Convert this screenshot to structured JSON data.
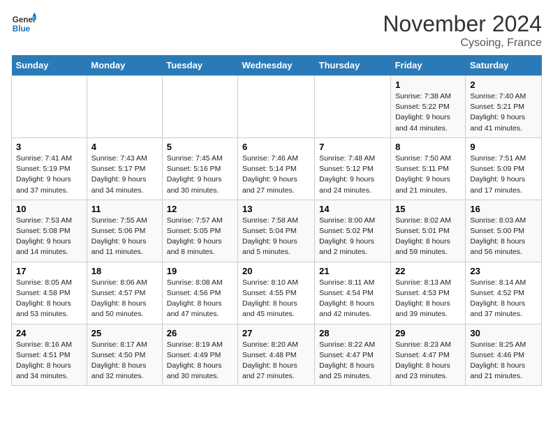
{
  "header": {
    "logo_line1": "General",
    "logo_line2": "Blue",
    "month": "November 2024",
    "location": "Cysoing, France"
  },
  "weekdays": [
    "Sunday",
    "Monday",
    "Tuesday",
    "Wednesday",
    "Thursday",
    "Friday",
    "Saturday"
  ],
  "weeks": [
    [
      {
        "day": "",
        "info": ""
      },
      {
        "day": "",
        "info": ""
      },
      {
        "day": "",
        "info": ""
      },
      {
        "day": "",
        "info": ""
      },
      {
        "day": "",
        "info": ""
      },
      {
        "day": "1",
        "info": "Sunrise: 7:38 AM\nSunset: 5:22 PM\nDaylight: 9 hours\nand 44 minutes."
      },
      {
        "day": "2",
        "info": "Sunrise: 7:40 AM\nSunset: 5:21 PM\nDaylight: 9 hours\nand 41 minutes."
      }
    ],
    [
      {
        "day": "3",
        "info": "Sunrise: 7:41 AM\nSunset: 5:19 PM\nDaylight: 9 hours\nand 37 minutes."
      },
      {
        "day": "4",
        "info": "Sunrise: 7:43 AM\nSunset: 5:17 PM\nDaylight: 9 hours\nand 34 minutes."
      },
      {
        "day": "5",
        "info": "Sunrise: 7:45 AM\nSunset: 5:16 PM\nDaylight: 9 hours\nand 30 minutes."
      },
      {
        "day": "6",
        "info": "Sunrise: 7:46 AM\nSunset: 5:14 PM\nDaylight: 9 hours\nand 27 minutes."
      },
      {
        "day": "7",
        "info": "Sunrise: 7:48 AM\nSunset: 5:12 PM\nDaylight: 9 hours\nand 24 minutes."
      },
      {
        "day": "8",
        "info": "Sunrise: 7:50 AM\nSunset: 5:11 PM\nDaylight: 9 hours\nand 21 minutes."
      },
      {
        "day": "9",
        "info": "Sunrise: 7:51 AM\nSunset: 5:09 PM\nDaylight: 9 hours\nand 17 minutes."
      }
    ],
    [
      {
        "day": "10",
        "info": "Sunrise: 7:53 AM\nSunset: 5:08 PM\nDaylight: 9 hours\nand 14 minutes."
      },
      {
        "day": "11",
        "info": "Sunrise: 7:55 AM\nSunset: 5:06 PM\nDaylight: 9 hours\nand 11 minutes."
      },
      {
        "day": "12",
        "info": "Sunrise: 7:57 AM\nSunset: 5:05 PM\nDaylight: 9 hours\nand 8 minutes."
      },
      {
        "day": "13",
        "info": "Sunrise: 7:58 AM\nSunset: 5:04 PM\nDaylight: 9 hours\nand 5 minutes."
      },
      {
        "day": "14",
        "info": "Sunrise: 8:00 AM\nSunset: 5:02 PM\nDaylight: 9 hours\nand 2 minutes."
      },
      {
        "day": "15",
        "info": "Sunrise: 8:02 AM\nSunset: 5:01 PM\nDaylight: 8 hours\nand 59 minutes."
      },
      {
        "day": "16",
        "info": "Sunrise: 8:03 AM\nSunset: 5:00 PM\nDaylight: 8 hours\nand 56 minutes."
      }
    ],
    [
      {
        "day": "17",
        "info": "Sunrise: 8:05 AM\nSunset: 4:58 PM\nDaylight: 8 hours\nand 53 minutes."
      },
      {
        "day": "18",
        "info": "Sunrise: 8:06 AM\nSunset: 4:57 PM\nDaylight: 8 hours\nand 50 minutes."
      },
      {
        "day": "19",
        "info": "Sunrise: 8:08 AM\nSunset: 4:56 PM\nDaylight: 8 hours\nand 47 minutes."
      },
      {
        "day": "20",
        "info": "Sunrise: 8:10 AM\nSunset: 4:55 PM\nDaylight: 8 hours\nand 45 minutes."
      },
      {
        "day": "21",
        "info": "Sunrise: 8:11 AM\nSunset: 4:54 PM\nDaylight: 8 hours\nand 42 minutes."
      },
      {
        "day": "22",
        "info": "Sunrise: 8:13 AM\nSunset: 4:53 PM\nDaylight: 8 hours\nand 39 minutes."
      },
      {
        "day": "23",
        "info": "Sunrise: 8:14 AM\nSunset: 4:52 PM\nDaylight: 8 hours\nand 37 minutes."
      }
    ],
    [
      {
        "day": "24",
        "info": "Sunrise: 8:16 AM\nSunset: 4:51 PM\nDaylight: 8 hours\nand 34 minutes."
      },
      {
        "day": "25",
        "info": "Sunrise: 8:17 AM\nSunset: 4:50 PM\nDaylight: 8 hours\nand 32 minutes."
      },
      {
        "day": "26",
        "info": "Sunrise: 8:19 AM\nSunset: 4:49 PM\nDaylight: 8 hours\nand 30 minutes."
      },
      {
        "day": "27",
        "info": "Sunrise: 8:20 AM\nSunset: 4:48 PM\nDaylight: 8 hours\nand 27 minutes."
      },
      {
        "day": "28",
        "info": "Sunrise: 8:22 AM\nSunset: 4:47 PM\nDaylight: 8 hours\nand 25 minutes."
      },
      {
        "day": "29",
        "info": "Sunrise: 8:23 AM\nSunset: 4:47 PM\nDaylight: 8 hours\nand 23 minutes."
      },
      {
        "day": "30",
        "info": "Sunrise: 8:25 AM\nSunset: 4:46 PM\nDaylight: 8 hours\nand 21 minutes."
      }
    ]
  ]
}
